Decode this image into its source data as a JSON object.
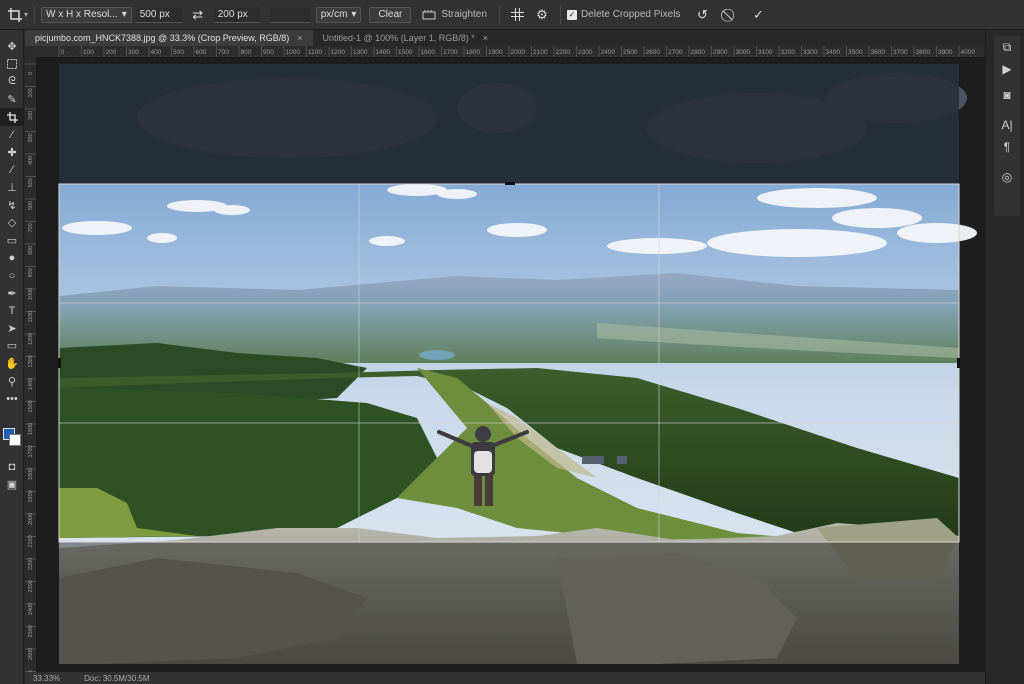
{
  "options_bar": {
    "ratio_preset": "W x H x Resol...",
    "width_value": "500 px",
    "height_value": "200 px",
    "resolution_value": "",
    "unit_select": "px/cm",
    "clear_label": "Clear",
    "straighten_label": "Straighten",
    "delete_cropped_label": "Delete Cropped Pixels",
    "delete_cropped_checked": true
  },
  "tabs": [
    {
      "label": "picjumbo.com_HNCK7388.jpg @ 33.3% (Crop Preview, RGB/8)",
      "close": "×",
      "active": true
    },
    {
      "label": "Untitled-1 @ 100% (Layer 1, RGB/8) *",
      "close": "×",
      "active": false
    }
  ],
  "ruler_h_ticks": [
    "0",
    "100",
    "200",
    "300",
    "400",
    "500",
    "600",
    "700",
    "800",
    "900",
    "1000",
    "1100",
    "1200",
    "1300",
    "1400",
    "1500",
    "1600",
    "1700",
    "1800",
    "1900",
    "2000",
    "2100",
    "2200",
    "2300",
    "2400",
    "2500",
    "2600",
    "2700",
    "2800",
    "2900",
    "3000",
    "3100",
    "3200",
    "3300",
    "3400",
    "3500",
    "3600",
    "3700",
    "3800",
    "3900",
    "4000"
  ],
  "ruler_v_ticks": [
    "0",
    "100",
    "200",
    "300",
    "400",
    "500",
    "600",
    "700",
    "800",
    "900",
    "1000",
    "1100",
    "1200",
    "1300",
    "1400",
    "1500",
    "1600",
    "1700",
    "1800",
    "1900",
    "2000",
    "2100",
    "2200",
    "2300",
    "2400",
    "2500",
    "2600",
    "2700"
  ],
  "status": {
    "zoom": "33.33%",
    "doc": "Doc: 30.5M/30.5M"
  },
  "colors": {
    "foreground": "#1d5fb5",
    "background": "#ffffff",
    "ui_dark": "#282828",
    "ui_panel": "#323232"
  },
  "tools": [
    "move-icon",
    "marquee-icon",
    "lasso-icon",
    "quick-select-icon",
    "crop-icon",
    "eyedropper-icon",
    "healing-brush-icon",
    "brush-icon",
    "clone-stamp-icon",
    "history-brush-icon",
    "eraser-icon",
    "gradient-icon",
    "blur-icon",
    "dodge-icon",
    "pen-icon",
    "type-icon",
    "path-select-icon",
    "rectangle-icon",
    "hand-icon",
    "zoom-icon",
    "more-icon"
  ],
  "right_panel_icons": [
    "history-icon",
    "play-icon",
    "properties-icon",
    "character-icon",
    "paragraph-icon",
    "libraries-icon"
  ]
}
